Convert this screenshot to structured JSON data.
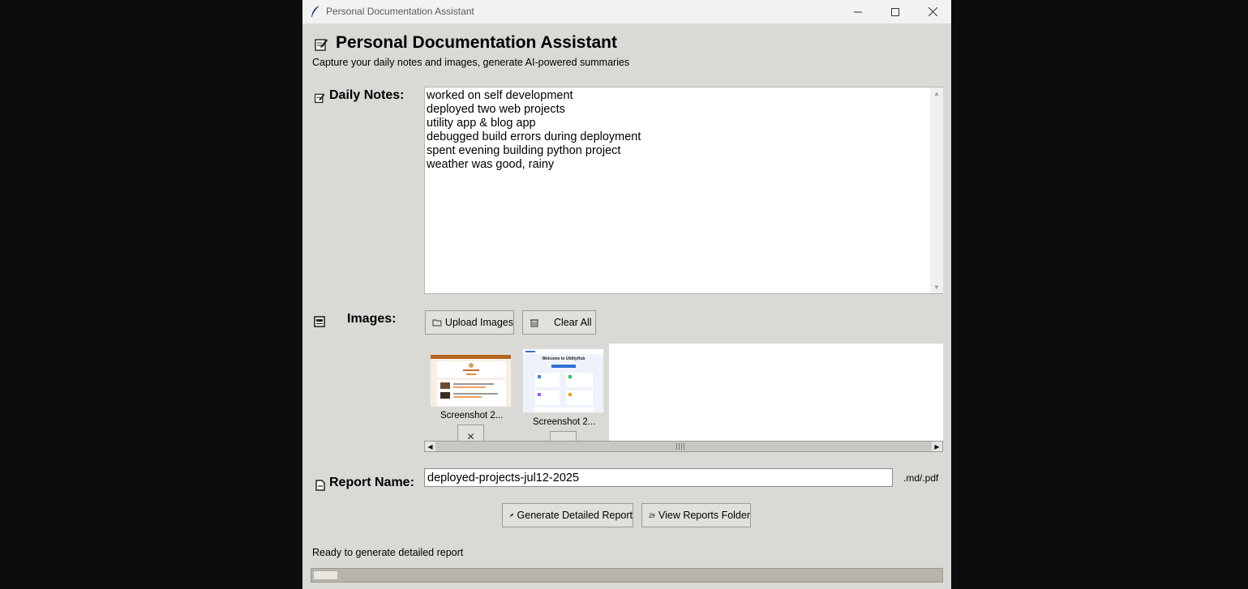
{
  "window": {
    "title": "Personal Documentation Assistant",
    "controls": {
      "minimize": "—",
      "maximize": "☐",
      "close": "✕"
    }
  },
  "header": {
    "title": "Personal Documentation Assistant",
    "subtitle": "Capture your daily notes and images, generate AI-powered summaries"
  },
  "notes": {
    "label": "Daily Notes:",
    "text": "worked on self development\ndeployed two web projects\nutility app & blog app\ndebugged build errors during deployment\nspent evening building python project\nweather was good, rainy"
  },
  "images": {
    "label": "Images:",
    "upload_label": "Upload Images",
    "clear_label": "Clear All",
    "items": [
      {
        "caption": "Screenshot 2...",
        "remove_label": "✕"
      },
      {
        "caption": "Screenshot 2...",
        "thumb_heading": "Welcome to UtilityHub",
        "remove_label": "✕"
      }
    ]
  },
  "report": {
    "label": "Report Name:",
    "value": "deployed-projects-jul12-2025",
    "extension": ".md/.pdf",
    "generate_label": "Generate Detailed Report",
    "view_folder_label": "View Reports Folder"
  },
  "status": {
    "text": "Ready to generate detailed report",
    "progress": 0.04
  },
  "colors": {
    "window_bg": "#dad9d5",
    "desktop_bg": "#0c0c0f",
    "titlebar_bg": "#f2f2f2",
    "accent_blue": "#2f6fd6"
  }
}
